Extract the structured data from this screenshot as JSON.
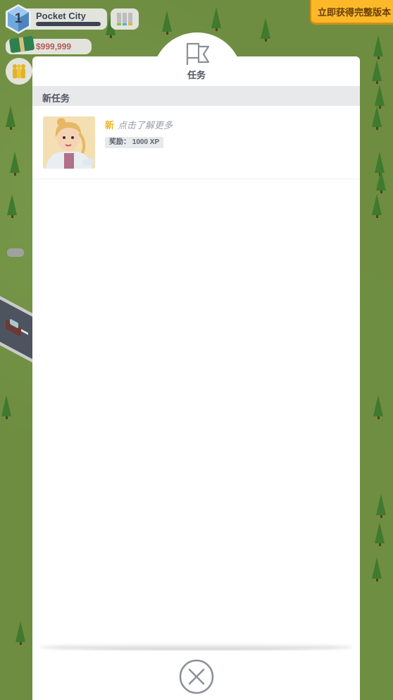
{
  "hud": {
    "level": "1",
    "city_name": "Pocket City",
    "money": "$999,999",
    "stats_colors": [
      "#8bc53f",
      "#5aa9e6",
      "#f2b526"
    ]
  },
  "promo": {
    "label": "立即获得完整版本"
  },
  "panel": {
    "tab_label": "任务",
    "tab_icon": "flag-icon",
    "section_title": "新任务",
    "quests": [
      {
        "new_badge": "新",
        "title": "点击了解更多",
        "reward": "奖励： 1000 XP"
      }
    ],
    "close_icon": "close-circle-icon"
  }
}
